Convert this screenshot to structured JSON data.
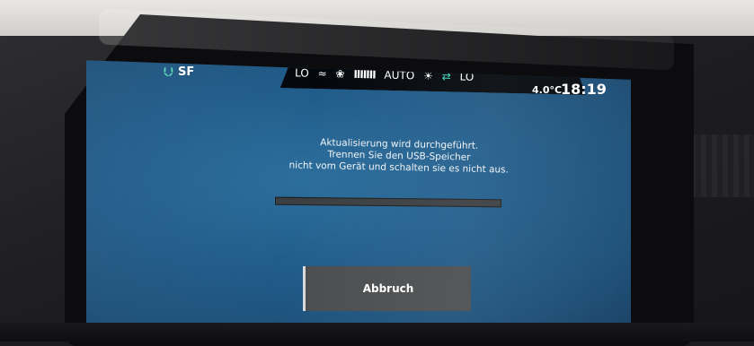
{
  "status_bar": {
    "usb_icon": "usb-icon",
    "source": "SF",
    "fan_left": "LO",
    "fan_right": "LO",
    "fan_bars": "IIIIIII",
    "mode": "AUTO",
    "outside_temp": "4.0°C",
    "time": "18:19",
    "accent_color": "#44d5bb"
  },
  "dialog": {
    "line1": "Aktualisierung wird durchgeführt.",
    "line2": "Trennen Sie den USB-Speicher",
    "line3": "nicht vom Gerät und schalten sie es nicht aus.",
    "progress": 0,
    "cancel_label": "Abbruch"
  }
}
